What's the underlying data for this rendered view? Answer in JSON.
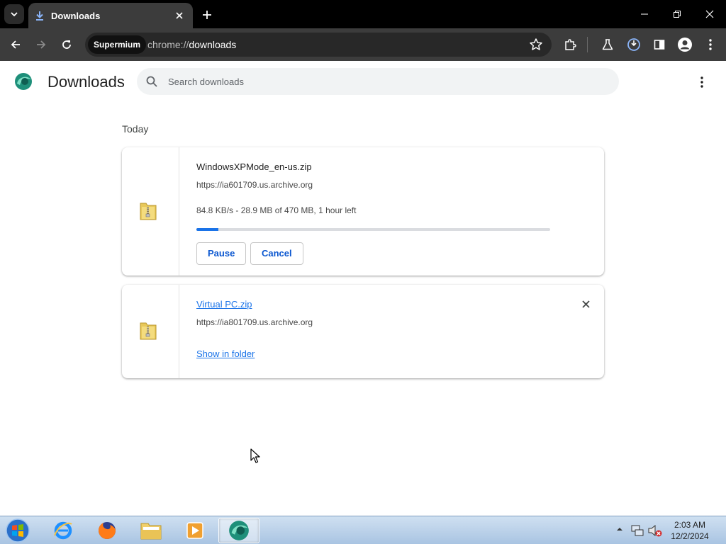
{
  "browser": {
    "tab": {
      "title": "Downloads"
    },
    "address": {
      "chip_label": "Supermium",
      "scheme": "chrome://",
      "path": "downloads"
    }
  },
  "page": {
    "title": "Downloads",
    "search": {
      "placeholder": "Search downloads",
      "value": ""
    },
    "section_label": "Today"
  },
  "downloads": [
    {
      "filename": "WindowsXPMode_en-us.zip",
      "source": "https://ia601709.us.archive.org",
      "status": "84.8 KB/s - 28.9 MB of 470 MB, 1 hour left",
      "progress_fraction": 0.0615,
      "pause_label": "Pause",
      "cancel_label": "Cancel"
    },
    {
      "filename": "Virtual PC.zip",
      "source": "https://ia801709.us.archive.org",
      "show_in_folder_label": "Show in folder"
    }
  ],
  "taskbar": {
    "clock_time": "2:03 AM",
    "clock_date": "12/2/2024",
    "apps": [
      "internet-explorer",
      "firefox",
      "file-explorer",
      "media-player",
      "supermium"
    ],
    "active_app": "supermium"
  },
  "colors": {
    "accent": "#1a73e8",
    "titlebar": "#000000",
    "toolbar": "#3c3c3c"
  }
}
